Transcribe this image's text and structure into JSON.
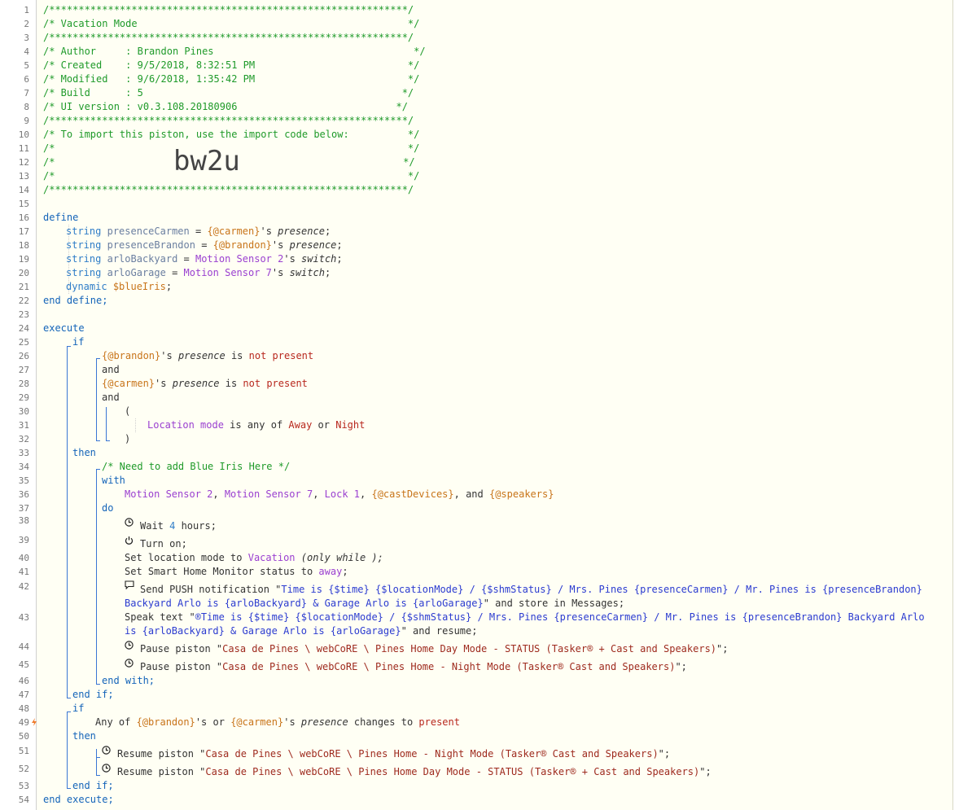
{
  "header": {
    "stars": "/*************************************************************/",
    "title": "/* Vacation Mode                                              */",
    "author": "/* Author     : Brandon Pines                                  */",
    "created": "/* Created    : 9/5/2018, 8:32:51 PM                          */",
    "modified": "/* Modified   : 9/6/2018, 1:35:42 PM                          */",
    "build": "/* Build      : 5                                            */",
    "ui_version": "/* UI version : v0.3.108.20180906                           */",
    "import_note": "/* To import this piston, use the import code below:          */",
    "blank_open": "/*                                                            */",
    "code_prefix": "/*              ",
    "import_code": "bw2u",
    "code_suffix": "                       */"
  },
  "define": {
    "kw_define": "define",
    "kw_end": "end define;",
    "vars": [
      {
        "type": "string",
        "name": "presenceCarmen",
        "eq": " = ",
        "src": "{@carmen}",
        "poss": "'s ",
        "attr": "presence",
        "semi": ";"
      },
      {
        "type": "string",
        "name": "presenceBrandon",
        "eq": " = ",
        "src": "{@brandon}",
        "poss": "'s ",
        "attr": "presence",
        "semi": ";"
      },
      {
        "type": "string",
        "name": "arloBackyard",
        "eq": " = ",
        "src": "Motion Sensor 2",
        "poss": "'s ",
        "attr": "switch",
        "semi": ";"
      },
      {
        "type": "string",
        "name": "arloGarage",
        "eq": " = ",
        "src": "Motion Sensor 7",
        "poss": "'s ",
        "attr": "switch",
        "semi": ";"
      }
    ],
    "dynamic_type": "dynamic",
    "dynamic_name": "$blueIris",
    "dynamic_semi": ";"
  },
  "execute": {
    "kw_execute": "execute",
    "kw_end": "end execute;",
    "if1": {
      "kw_if": "if",
      "c1_var": "{@brandon}",
      "c1_poss": "'s ",
      "c1_attr": "presence",
      "c1_is": " is ",
      "c1_not": "not",
      "c1_val": " present",
      "and1": "and",
      "c2_var": "{@carmen}",
      "c2_poss": "'s ",
      "c2_attr": "presence",
      "c2_is": " is ",
      "c2_not": "not",
      "c2_val": " present",
      "and2": "and",
      "open_paren": "(",
      "c3_dev": "Location mode",
      "c3_op": " is any of ",
      "c3_v1": "Away",
      "c3_or": " or ",
      "c3_v2": "Night",
      "close_paren": ")",
      "kw_then": "then",
      "comment": "/* Need to add Blue Iris Here */",
      "kw_with": "with",
      "with_d1": "Motion Sensor 2",
      "with_sep1": ", ",
      "with_d2": "Motion Sensor 7",
      "with_sep2": ", ",
      "with_d3": "Lock 1",
      "with_sep3": ", ",
      "with_v1": "{@castDevices}",
      "with_and": ", and ",
      "with_v2": "{@speakers}",
      "kw_do": "do",
      "wait_pre": "Wait ",
      "wait_n": "4",
      "wait_post": " hours;",
      "turn_on": "Turn on;",
      "setmode_pre": "Set location mode to ",
      "setmode_val": "Vacation",
      "setmode_only": " (only while );",
      "shm_pre": "Set Smart Home Monitor status to ",
      "shm_val": "away",
      "shm_semi": ";",
      "push_pre": "Send PUSH notification \"",
      "push_msg1": "Time is {$time} {$locationMode} / {$shmStatus} / Mrs. Pines {presenceCarmen} / Mr. Pines is {presenceBrandon}",
      "push_msg2": "Backyard Arlo is {arloBackyard} & Garage Arlo is {arloGarage}",
      "push_post": "\" and store in Messages;",
      "speak_pre": "Speak text \"",
      "speak_msg1": "®Time is {$time} {$locationMode} / {$shmStatus} / Mrs. Pines {presenceCarmen} / Mr. Pines is {presenceBrandon} Backyard Arlo",
      "speak_msg2": "is {arloBackyard} & Garage Arlo is {arloGarage}",
      "speak_post": "\" and resume;",
      "pause1_pre": "Pause piston \"",
      "pause1_val": "Casa de Pines \\ webCoRE \\ Pines Home Day Mode - STATUS (Tasker® + Cast and Speakers)",
      "pause1_post": "\";",
      "pause2_pre": "Pause piston \"",
      "pause2_val": "Casa de Pines \\ webCoRE \\ Pines Home - Night Mode (Tasker® Cast and Speakers)",
      "pause2_post": "\";",
      "end_with": "end with;",
      "end_if": "end if;"
    },
    "if2": {
      "kw_if": "if",
      "any_of": "Any of ",
      "v1": "{@brandon}",
      "or": "'s or ",
      "v2": "{@carmen}",
      "poss": "'s ",
      "attr": "presence",
      "op": " changes to ",
      "val": "present",
      "kw_then": "then",
      "resume1_pre": "Resume piston \"",
      "resume1_val": "Casa de Pines \\ webCoRE \\ Pines Home - Night Mode (Tasker® Cast and Speakers)",
      "resume1_post": "\";",
      "resume2_pre": "Resume piston \"",
      "resume2_val": "Casa de Pines \\ webCoRE \\ Pines Home Day Mode - STATUS (Tasker® + Cast and Speakers)",
      "resume2_post": "\";",
      "end_if": "end if;"
    }
  },
  "line_numbers": [
    "1",
    "2",
    "3",
    "4",
    "5",
    "6",
    "7",
    "8",
    "9",
    "10",
    "11",
    "12",
    "13",
    "14",
    "15",
    "16",
    "17",
    "18",
    "19",
    "20",
    "21",
    "22",
    "23",
    "24",
    "25",
    "26",
    "27",
    "28",
    "29",
    "30",
    "31",
    "32",
    "33",
    "34",
    "35",
    "36",
    "37",
    "38",
    "39",
    "40",
    "41",
    "42",
    "43",
    "44",
    "45",
    "46",
    "47",
    "48",
    "49",
    "50",
    "51",
    "52",
    "53",
    "54"
  ],
  "icons": {
    "clock": "clock-icon",
    "power": "power-icon",
    "message": "message-icon",
    "bolt": "bolt-icon"
  },
  "colors": {
    "comment": "#1f9a2a",
    "keyword": "#1464b9",
    "variable": "#c8741a",
    "device": "#9a3fd0",
    "value": "#b8281e",
    "bracket": "#3a76d4"
  }
}
